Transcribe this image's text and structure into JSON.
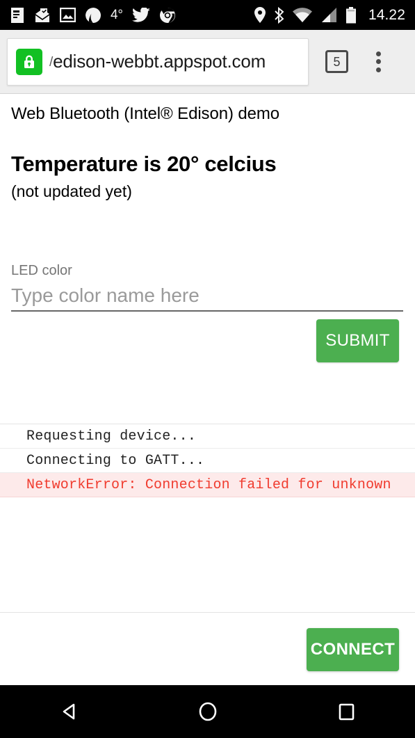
{
  "statusbar": {
    "icons_left": [
      {
        "name": "news-article-icon",
        "glyph": "article"
      },
      {
        "name": "mail-open-check-icon",
        "glyph": "mail"
      },
      {
        "name": "photo-image-icon",
        "glyph": "photo"
      },
      {
        "name": "mountain-logo-icon",
        "glyph": "mountain"
      },
      {
        "name": "twitter-bird-icon",
        "glyph": "twitter"
      },
      {
        "name": "chrome-browser-icon",
        "glyph": "chrome"
      }
    ],
    "temperature": "4°",
    "icons_right": [
      {
        "name": "location-pin-icon",
        "glyph": "pin"
      },
      {
        "name": "bluetooth-icon",
        "glyph": "bluetooth"
      },
      {
        "name": "wifi-icon",
        "glyph": "wifi"
      },
      {
        "name": "cell-signal-icon",
        "glyph": "signal"
      },
      {
        "name": "battery-icon",
        "glyph": "battery"
      }
    ],
    "clock": "14.22"
  },
  "browser": {
    "lock_icon": "lock-icon",
    "url_prefix": "/",
    "url": "edison-webbt.appspot.com",
    "tab_count": "5",
    "menu_icon": "overflow-menu-icon"
  },
  "page": {
    "title": "Web Bluetooth (Intel® Edison) demo",
    "temperature_heading": "Temperature is 20° celcius",
    "temperature_status": "(not updated yet)",
    "field": {
      "label": "LED color",
      "placeholder": "Type color name here",
      "value": ""
    },
    "submit_label": "SUBMIT",
    "connect_label": "CONNECT",
    "log": [
      {
        "text": "Requesting device...",
        "type": "info"
      },
      {
        "text": "Connecting to GATT...",
        "type": "info"
      },
      {
        "text": "NetworkError: Connection failed for unknown",
        "type": "error"
      }
    ]
  },
  "navbar": {
    "back": "back-triangle-icon",
    "home": "home-circle-icon",
    "recents": "recents-square-icon"
  },
  "colors": {
    "accent_green": "#4CAF50",
    "lock_green": "#12C023",
    "error_red": "#f03b2e",
    "error_bg": "#fdeaea"
  }
}
